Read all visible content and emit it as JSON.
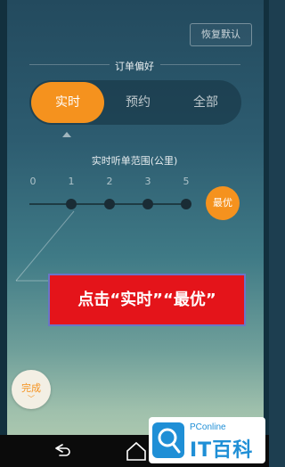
{
  "header": {
    "restore_label": "恢复默认"
  },
  "order_pref": {
    "title": "订单偏好",
    "options": [
      "实时",
      "预约",
      "全部"
    ],
    "selected": "实时"
  },
  "range": {
    "title": "实时听单范围(公里)",
    "ticks": [
      "0",
      "1",
      "2",
      "3",
      "5"
    ],
    "best_label": "最优"
  },
  "callout": {
    "text": "点击“实时”“最优”"
  },
  "done": {
    "label": "完成",
    "chevron": "﹀"
  },
  "watermark": {
    "top": "PConline",
    "bottom": "IT百科"
  },
  "colors": {
    "accent": "#f5921e",
    "callout_bg": "#e4141a",
    "watermark_blue": "#1f8fd6"
  },
  "icons": [
    "back-icon",
    "home-icon",
    "search-logo-icon"
  ]
}
